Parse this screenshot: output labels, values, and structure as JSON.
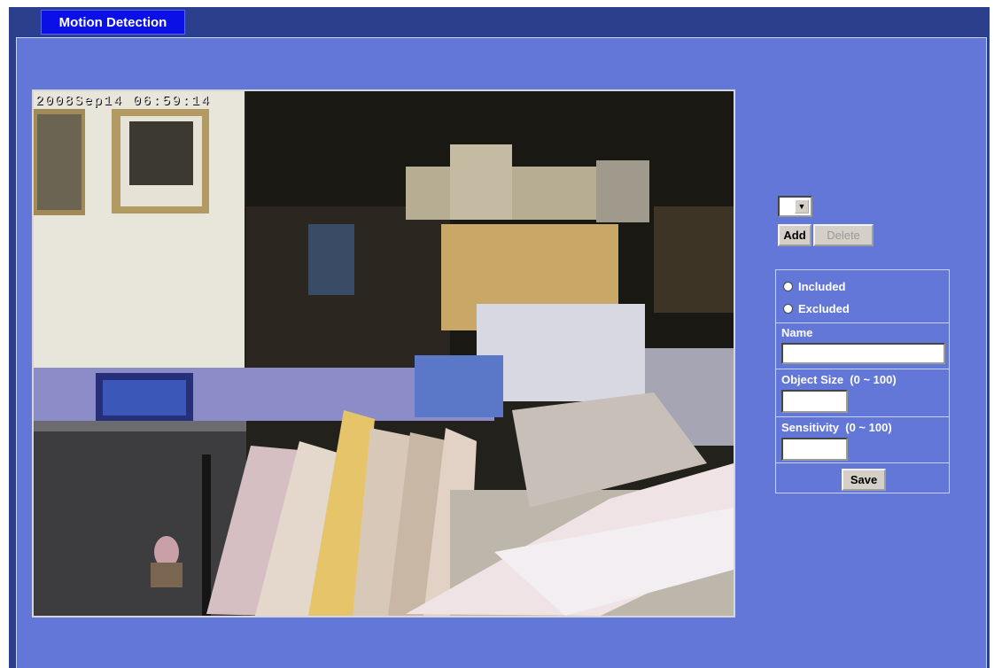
{
  "header": {
    "tab_label": "Motion Detection"
  },
  "video": {
    "timestamp": "2008Sep14  06:59:14"
  },
  "window_select": {
    "selected_value": ""
  },
  "buttons": {
    "add_label": "Add",
    "delete_label": "Delete",
    "save_label": "Save"
  },
  "form": {
    "radio_included_label": "Included",
    "radio_excluded_label": "Excluded",
    "name_label": "Name",
    "name_value": "",
    "object_size_label": "Object Size  (0 ~ 100)",
    "object_size_value": "",
    "sensitivity_label": "Sensitivity  (0 ~ 100)",
    "sensitivity_value": ""
  },
  "colors": {
    "frame": "#2b3f8c",
    "panel": "#6377d9",
    "tab": "#0a10e6"
  }
}
